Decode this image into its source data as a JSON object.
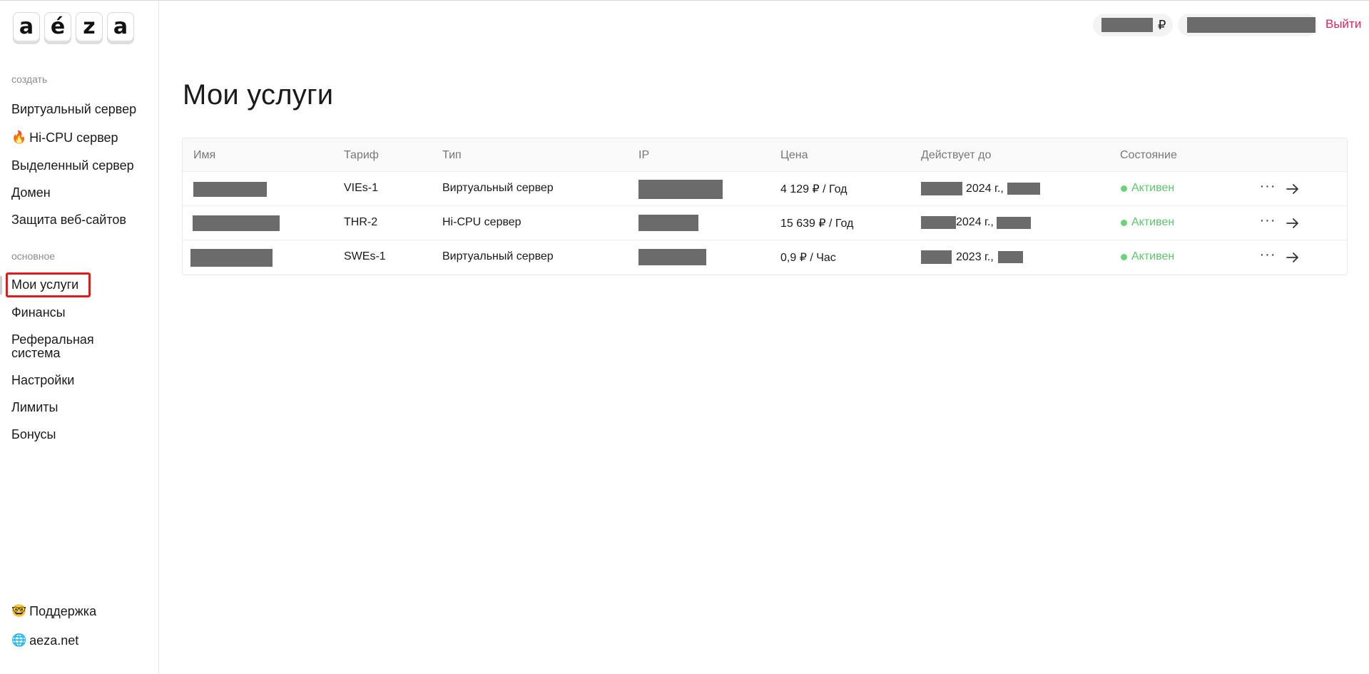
{
  "logo": {
    "letters": [
      "a",
      "é",
      "z",
      "a"
    ]
  },
  "sidebar": {
    "create_label": "создать",
    "create_items": [
      {
        "label": "Виртуальный сервер"
      },
      {
        "emoji": "🔥",
        "label": "Hi-CPU сервер"
      },
      {
        "label": "Выделенный сервер"
      },
      {
        "label": "Домен"
      },
      {
        "label": "Защита веб-сайтов"
      }
    ],
    "main_label": "основное",
    "main_items": [
      {
        "label": "Мои услуги",
        "active": true
      },
      {
        "label": "Финансы"
      },
      {
        "label": "Реферальная система"
      },
      {
        "label": "Настройки"
      },
      {
        "label": "Лимиты"
      },
      {
        "label": "Бонусы"
      }
    ],
    "footer_items": [
      {
        "emoji": "🤓",
        "label": "Поддержка"
      },
      {
        "emoji": "🌐",
        "label": "aeza.net"
      }
    ]
  },
  "header": {
    "currency": "₽",
    "logout": "Выйти"
  },
  "page": {
    "title": "Мои услуги"
  },
  "table": {
    "headers": [
      "Имя",
      "Тариф",
      "Тип",
      "IP",
      "Цена",
      "Действует до",
      "Состояние"
    ],
    "rows": [
      {
        "tariff": "VIEs-1",
        "type": "Виртуальный сервер",
        "price": "4 129 ₽ / Год",
        "expires_year": "2024 г.,",
        "status": "Активен"
      },
      {
        "tariff": "THR-2",
        "type": "Hi-CPU сервер",
        "price": "15 639 ₽ / Год",
        "expires_year": "2024 г.,",
        "status": "Активен"
      },
      {
        "tariff": "SWEs-1",
        "type": "Виртуальный сервер",
        "price": "0,9 ₽ / Час",
        "expires_year": "2023 г.,",
        "status": "Активен"
      }
    ]
  },
  "colors": {
    "accent_logout": "#e0245e",
    "status_active": "#5ec66f",
    "highlight_border": "#e01b1b"
  },
  "icons": [
    "more-horizontal-icon",
    "arrow-right-icon"
  ]
}
